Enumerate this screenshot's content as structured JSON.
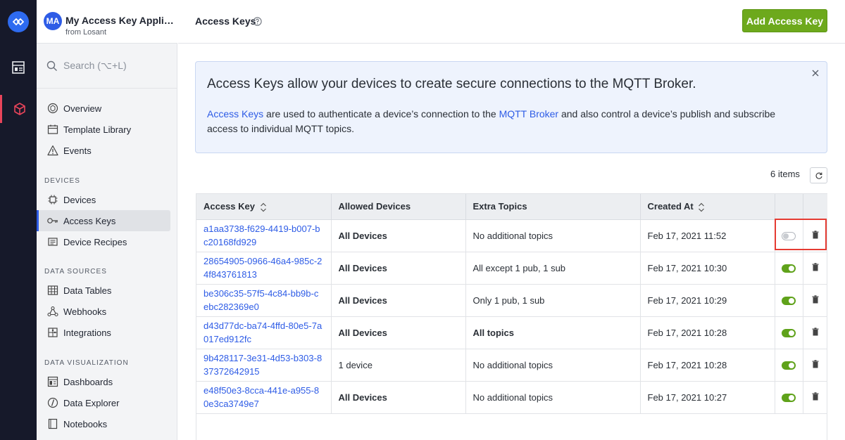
{
  "app": {
    "avatar_initials": "MA",
    "name": "My Access Key Application",
    "subtitle": "from Losant"
  },
  "search": {
    "placeholder": "Search (⌥+L)"
  },
  "sidebar": {
    "items_top": [
      {
        "label": "Overview",
        "icon": "overview-icon"
      },
      {
        "label": "Template Library",
        "icon": "template-library-icon"
      },
      {
        "label": "Events",
        "icon": "warning-icon"
      }
    ],
    "devices_section": "DEVICES",
    "devices_items": [
      {
        "label": "Devices",
        "icon": "chip-icon"
      },
      {
        "label": "Access Keys",
        "icon": "key-icon"
      },
      {
        "label": "Device Recipes",
        "icon": "recipe-icon"
      }
    ],
    "data_sources_section": "DATA SOURCES",
    "data_sources_items": [
      {
        "label": "Data Tables",
        "icon": "table-icon"
      },
      {
        "label": "Webhooks",
        "icon": "webhook-icon"
      },
      {
        "label": "Integrations",
        "icon": "puzzle-icon"
      }
    ],
    "data_viz_section": "DATA VISUALIZATION",
    "data_viz_items": [
      {
        "label": "Dashboards",
        "icon": "dashboard-icon"
      },
      {
        "label": "Data Explorer",
        "icon": "data-explorer-icon"
      },
      {
        "label": "Notebooks",
        "icon": "notebook-icon"
      }
    ],
    "active": "Access Keys"
  },
  "header": {
    "title": "Access Keys",
    "add_button": "Add Access Key"
  },
  "info": {
    "title": "Access Keys allow your devices to create secure connections to the MQTT Broker.",
    "link1": "Access Keys",
    "text1": " are used to authenticate a device’s connection to the ",
    "link2": "MQTT Broker",
    "text2": " and also control a device’s publish and subscribe access to individual MQTT topics."
  },
  "count_text": "6 items",
  "table": {
    "columns": [
      "Access Key",
      "Allowed Devices",
      "Extra Topics",
      "Created At"
    ],
    "rows": [
      {
        "key": "a1aa3738-f629-4419-b007-bc20168fd929",
        "devices": "All Devices",
        "devices_bold": true,
        "topics": "No additional topics",
        "topics_bold": false,
        "created": "Feb 17, 2021 11:52",
        "enabled": false
      },
      {
        "key": "28654905-0966-46a4-985c-24f843761813",
        "devices": "All Devices",
        "devices_bold": true,
        "topics": "All except 1 pub, 1 sub",
        "topics_bold": false,
        "created": "Feb 17, 2021 10:30",
        "enabled": true
      },
      {
        "key": "be306c35-57f5-4c84-bb9b-cebc282369e0",
        "devices": "All Devices",
        "devices_bold": true,
        "topics": "Only 1 pub, 1 sub",
        "topics_bold": false,
        "created": "Feb 17, 2021 10:29",
        "enabled": true
      },
      {
        "key": "d43d77dc-ba74-4ffd-80e5-7a017ed912fc",
        "devices": "All Devices",
        "devices_bold": true,
        "topics": "All topics",
        "topics_bold": true,
        "created": "Feb 17, 2021 10:28",
        "enabled": true
      },
      {
        "key": "9b428117-3e31-4d53-b303-837372642915",
        "devices": "1 device",
        "devices_bold": false,
        "topics": "No additional topics",
        "topics_bold": false,
        "created": "Feb 17, 2021 10:28",
        "enabled": true
      },
      {
        "key": "e48f50e3-8cca-441e-a955-80e3ca3749e7",
        "devices": "All Devices",
        "devices_bold": true,
        "topics": "No additional topics",
        "topics_bold": false,
        "created": "Feb 17, 2021 10:27",
        "enabled": true
      }
    ]
  },
  "colors": {
    "rail": "#16192a",
    "accent_blue": "#2e5ce6",
    "add_button_green": "#6da91c",
    "toggle_on": "#5fa21a",
    "highlight_red": "#e53b32"
  }
}
